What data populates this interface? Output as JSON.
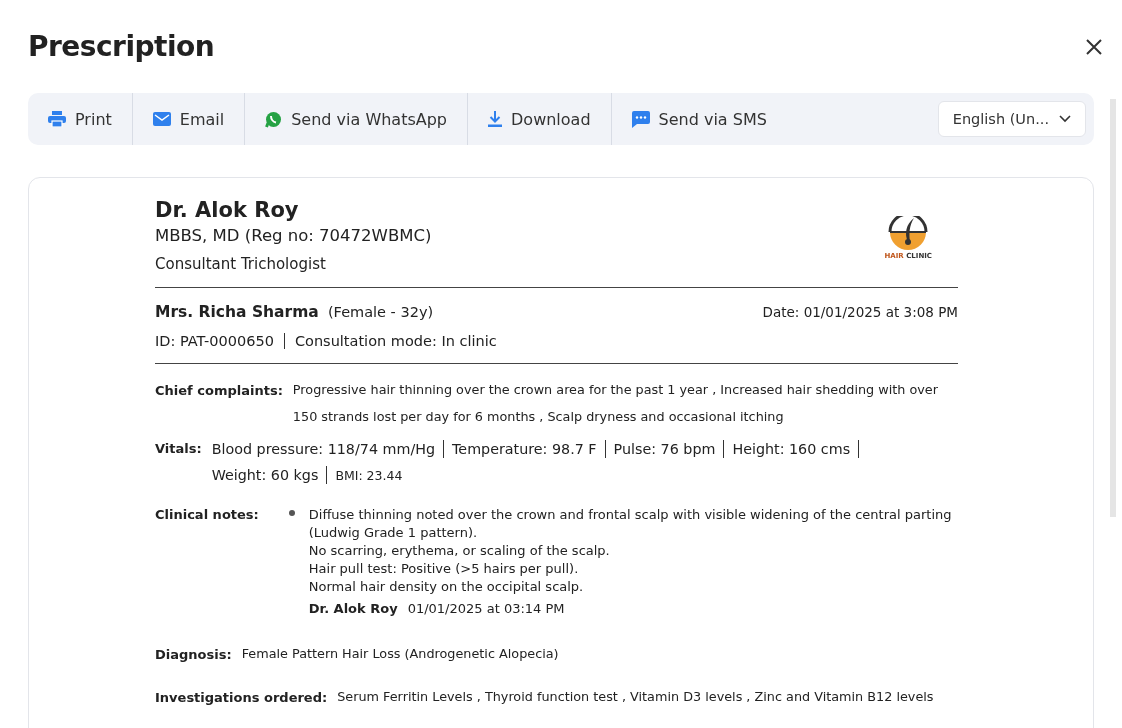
{
  "title": "Prescription",
  "toolbar": [
    {
      "kind": "print",
      "label": "Print"
    },
    {
      "kind": "email",
      "label": "Email"
    },
    {
      "kind": "whatsapp",
      "label": "Send via WhatsApp"
    },
    {
      "kind": "download",
      "label": "Download"
    },
    {
      "kind": "sms",
      "label": "Send via SMS"
    }
  ],
  "language": {
    "value": "English (Un..."
  },
  "doctor": {
    "name": "Dr. Alok Roy",
    "qualification": "MBBS, MD (Reg no: 70472WBMC)",
    "role": "Consultant Trichologist",
    "logo_text_1": "HAIR",
    "logo_text_2": "CLINIC"
  },
  "patient": {
    "name": "Mrs. Richa Sharma",
    "details": "(Female - 32y)",
    "date": "Date: 01/01/2025 at 3:08 PM",
    "id": "ID: PAT-0000650",
    "mode": "Consultation mode: In clinic"
  },
  "chief_complaints": {
    "label": "Chief complaints:",
    "text": "Progressive hair thinning over the crown area for the past 1 year ,  Increased hair shedding with over 150 strands lost per day for 6 months ,  Scalp dryness and occasional itching"
  },
  "vitals": {
    "label": "Vitals:",
    "items": [
      {
        "text": "Blood pressure: 118/74 mm/Hg",
        "kind": "main"
      },
      {
        "text": "Temperature: 98.7 F",
        "kind": "main"
      },
      {
        "text": "Pulse: 76 bpm",
        "kind": "main"
      },
      {
        "text": "Height: 160 cms",
        "kind": "main"
      },
      {
        "text": "Weight: 60 kgs",
        "kind": "main"
      },
      {
        "text": "BMI: 23.44",
        "kind": "minor"
      }
    ]
  },
  "clinical_notes": {
    "label": "Clinical notes:",
    "lines": [
      "Diffuse thinning noted over the crown and frontal scalp with visible widening of the central parting (Ludwig Grade 1 pattern).",
      "No scarring, erythema, or scaling of the scalp.",
      "Hair pull test: Positive (>5 hairs per pull).",
      "Normal hair density on the occipital scalp."
    ],
    "author": "Dr. Alok Roy",
    "time": "01/01/2025 at 03:14 PM"
  },
  "diagnosis": {
    "label": "Diagnosis:",
    "text": "Female Pattern Hair Loss (Androgenetic Alopecia)"
  },
  "investigations": {
    "label": "Investigations ordered:",
    "text": "Serum Ferritin Levels ,  Thyroid function test ,  Vitamin D3 levels ,  Zinc and Vitamin B12 levels"
  }
}
